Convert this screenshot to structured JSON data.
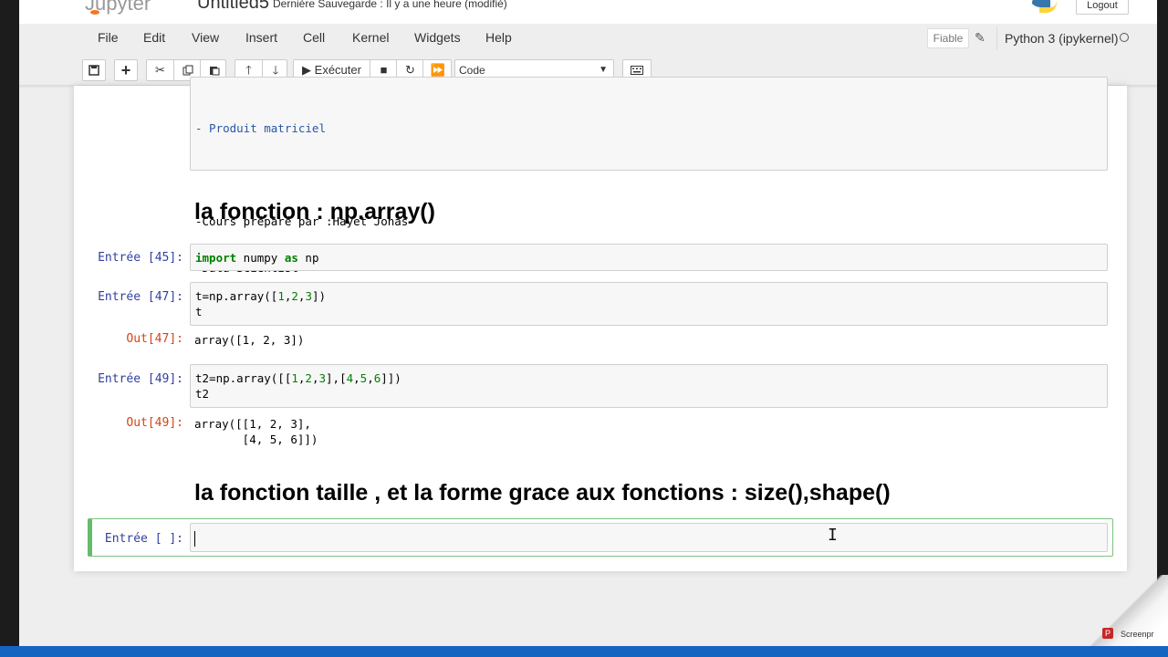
{
  "header": {
    "logo_text": "Jupyter",
    "notebook_name": "Untitled5",
    "save_status": "Dernière Sauvegarde : Il y a une heure  (modifié)",
    "logout_label": "Logout"
  },
  "menubar": {
    "items": [
      "File",
      "Edit",
      "View",
      "Insert",
      "Cell",
      "Kernel",
      "Widgets",
      "Help"
    ],
    "trusted_label": "Fiable",
    "kernel_name": "Python 3 (ipykernel)"
  },
  "toolbar": {
    "run_label": "Exécuter",
    "cell_type": "Code"
  },
  "cells": {
    "markdown": {
      "line1": "- Produit matriciel",
      "line2": "-Cours préparé par :Hayet Jonas",
      "line3": "-Data Scientist"
    },
    "heading1": "la fonction : np.array()",
    "cell45": {
      "prompt": "Entrée [45]:",
      "code": "import numpy as np"
    },
    "cell47": {
      "prompt": "Entrée [47]:",
      "code": "t=np.array([1,2,3])\nt",
      "out_prompt": "Out[47]:",
      "output": "array([1, 2, 3])"
    },
    "cell49": {
      "prompt": "Entrée [49]:",
      "code": "t2=np.array([[1,2,3],[4,5,6]])\nt2",
      "out_prompt": "Out[49]:",
      "output": "array([[1, 2, 3],\n       [4, 5, 6]])"
    },
    "heading2": "la fonction taille , et la forme grace aux fonctions : size(),shape()",
    "active": {
      "prompt": "Entrée [ ]:",
      "code": ""
    }
  },
  "overlay": {
    "recorder_label": "Screenpr",
    "recorder_badge": "P"
  }
}
